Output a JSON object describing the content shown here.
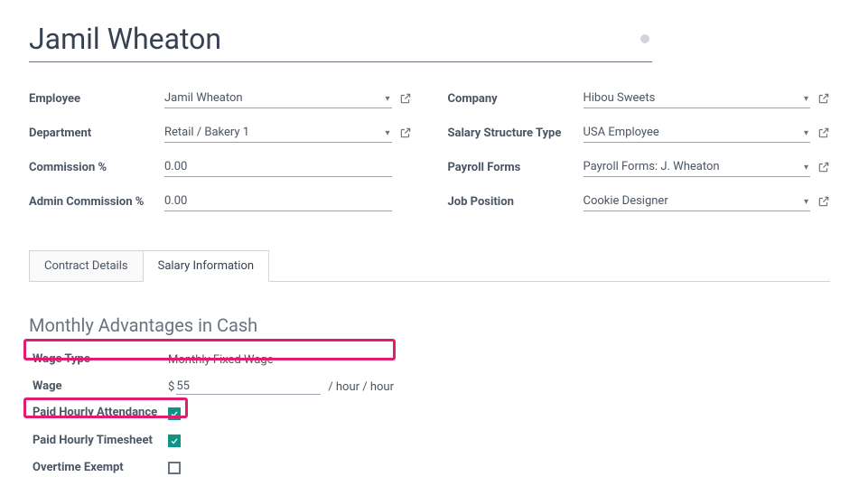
{
  "title": "Jamil Wheaton",
  "left": {
    "employee_label": "Employee",
    "employee_value": "Jamil Wheaton",
    "department_label": "Department",
    "department_value": "Retail / Bakery 1",
    "commission_label": "Commission %",
    "commission_value": "0.00",
    "admin_commission_label": "Admin Commission %",
    "admin_commission_value": "0.00"
  },
  "right": {
    "company_label": "Company",
    "company_value": "Hibou Sweets",
    "structure_label": "Salary Structure Type",
    "structure_value": "USA Employee",
    "payroll_label": "Payroll Forms",
    "payroll_value": "Payroll Forms: J. Wheaton",
    "job_label": "Job Position",
    "job_value": "Cookie Designer"
  },
  "tabs": {
    "contract": "Contract Details",
    "salary": "Salary Information"
  },
  "section": {
    "heading": "Monthly Advantages in Cash",
    "wage_type_label": "Wage Type",
    "wage_type_value": "Monthly Fixed Wage",
    "wage_label": "Wage",
    "wage_currency": "$",
    "wage_value": "55",
    "wage_unit": "/ hour / hour",
    "paid_attendance_label": "Paid Hourly Attendance",
    "paid_timesheet_label": "Paid Hourly Timesheet",
    "overtime_label": "Overtime Exempt"
  }
}
